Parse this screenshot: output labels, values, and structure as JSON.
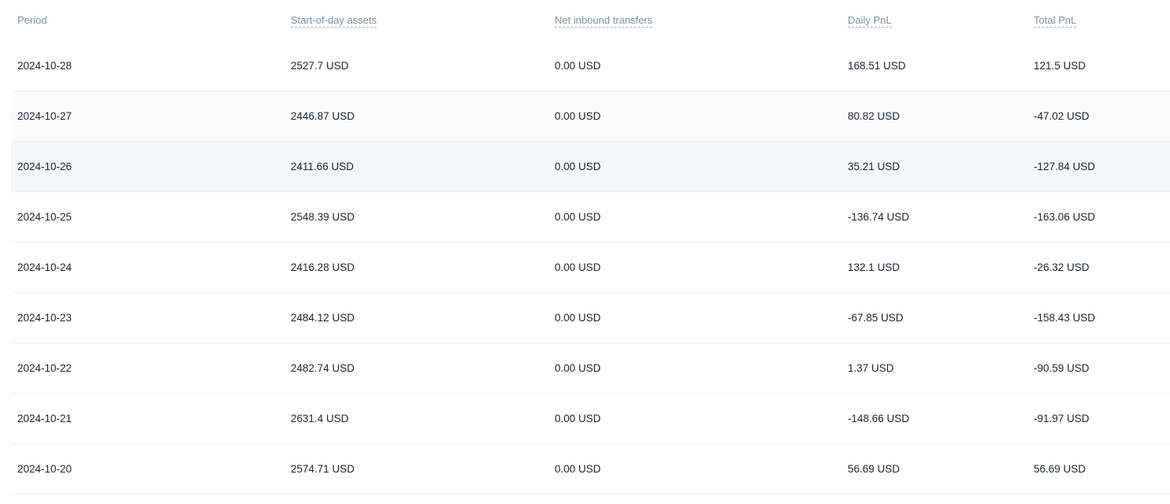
{
  "table": {
    "headers": {
      "period": "Period",
      "start_assets": "Start-of-day assets",
      "net_inbound": "Net inbound transfers",
      "daily_pnl": "Daily PnL",
      "total_pnl": "Total PnL"
    },
    "rows": [
      {
        "period": "2024-10-28",
        "start_assets": "2527.7 USD",
        "net_inbound": "0.00 USD",
        "daily_pnl": "168.51 USD",
        "total_pnl": "121.5 USD"
      },
      {
        "period": "2024-10-27",
        "start_assets": "2446.87 USD",
        "net_inbound": "0.00 USD",
        "daily_pnl": "80.82 USD",
        "total_pnl": "-47.02 USD"
      },
      {
        "period": "2024-10-26",
        "start_assets": "2411.66 USD",
        "net_inbound": "0.00 USD",
        "daily_pnl": "35.21 USD",
        "total_pnl": "-127.84 USD"
      },
      {
        "period": "2024-10-25",
        "start_assets": "2548.39 USD",
        "net_inbound": "0.00 USD",
        "daily_pnl": "-136.74 USD",
        "total_pnl": "-163.06 USD"
      },
      {
        "period": "2024-10-24",
        "start_assets": "2416.28 USD",
        "net_inbound": "0.00 USD",
        "daily_pnl": "132.1 USD",
        "total_pnl": "-26.32 USD"
      },
      {
        "period": "2024-10-23",
        "start_assets": "2484.12 USD",
        "net_inbound": "0.00 USD",
        "daily_pnl": "-67.85 USD",
        "total_pnl": "-158.43 USD"
      },
      {
        "period": "2024-10-22",
        "start_assets": "2482.74 USD",
        "net_inbound": "0.00 USD",
        "daily_pnl": "1.37 USD",
        "total_pnl": "-90.59 USD"
      },
      {
        "period": "2024-10-21",
        "start_assets": "2631.4 USD",
        "net_inbound": "0.00 USD",
        "daily_pnl": "-148.66 USD",
        "total_pnl": "-91.97 USD"
      },
      {
        "period": "2024-10-20",
        "start_assets": "2574.71 USD",
        "net_inbound": "0.00 USD",
        "daily_pnl": "56.69 USD",
        "total_pnl": "56.69 USD"
      }
    ]
  }
}
